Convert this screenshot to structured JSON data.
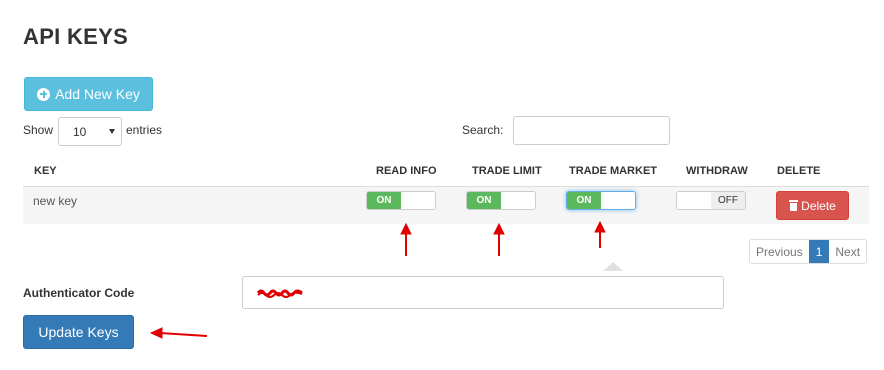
{
  "page": {
    "title": "API KEYS"
  },
  "toolbar": {
    "add_label": "Add New Key"
  },
  "length": {
    "show_label": "Show",
    "value": "10",
    "entries_label": "entries"
  },
  "search": {
    "label": "Search:",
    "value": ""
  },
  "table": {
    "headers": {
      "key": "KEY",
      "read_info": "READ INFO",
      "trade_limit": "TRADE LIMIT",
      "trade_market": "TRADE MARKET",
      "withdraw": "WITHDRAW",
      "delete": "DELETE"
    },
    "rows": [
      {
        "name": "new key",
        "read_info": "ON",
        "trade_limit": "ON",
        "trade_market": "ON",
        "withdraw": "OFF",
        "delete_label": "Delete"
      }
    ]
  },
  "pagination": {
    "previous": "Previous",
    "current": "1",
    "next": "Next"
  },
  "auth": {
    "label": "Authenticator Code"
  },
  "actions": {
    "update_label": "Update Keys"
  },
  "colors": {
    "accent_info": "#5bc0de",
    "toggle_on": "#5cb85c",
    "danger": "#d9534f",
    "primary": "#337ab7",
    "annotation": "#e00000"
  },
  "icons": {
    "add": "plus-circle-icon",
    "delete": "trash-icon",
    "select": "caret-down-icon"
  }
}
